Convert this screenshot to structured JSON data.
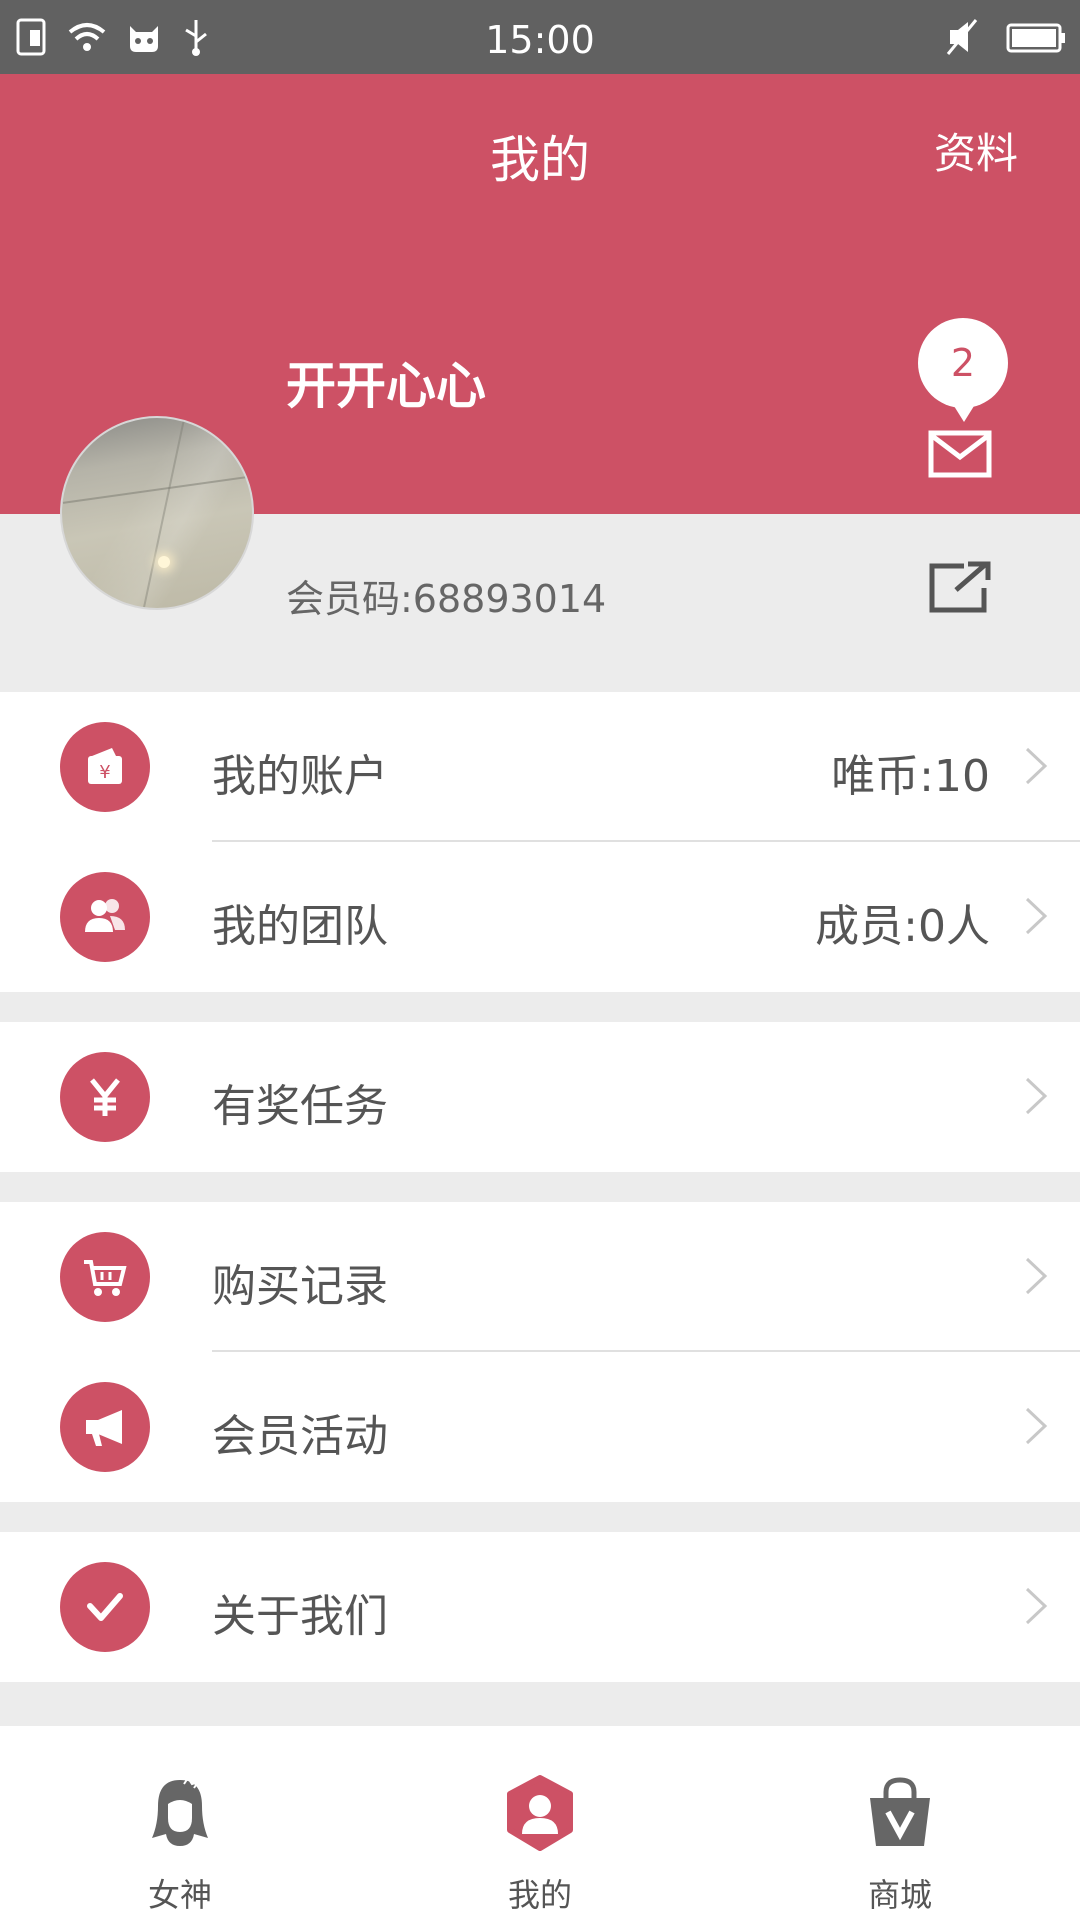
{
  "status_bar": {
    "time": "15:00"
  },
  "header": {
    "title": "我的",
    "profile_link": "资料"
  },
  "profile": {
    "username": "开开心心",
    "member_code": "会员码:68893014",
    "message_count": "2"
  },
  "menu": {
    "account": {
      "label": "我的账户",
      "value": "唯币:10"
    },
    "team": {
      "label": "我的团队",
      "value": "成员:0人"
    },
    "tasks": {
      "label": "有奖任务"
    },
    "purchases": {
      "label": "购买记录"
    },
    "events": {
      "label": "会员活动"
    },
    "about": {
      "label": "关于我们"
    }
  },
  "bottom_nav": {
    "goddess": "女神",
    "mine": "我的",
    "mall": "商城"
  },
  "colors": {
    "accent": "#cd5165",
    "status_bar": "#616161",
    "background": "#ececec"
  }
}
